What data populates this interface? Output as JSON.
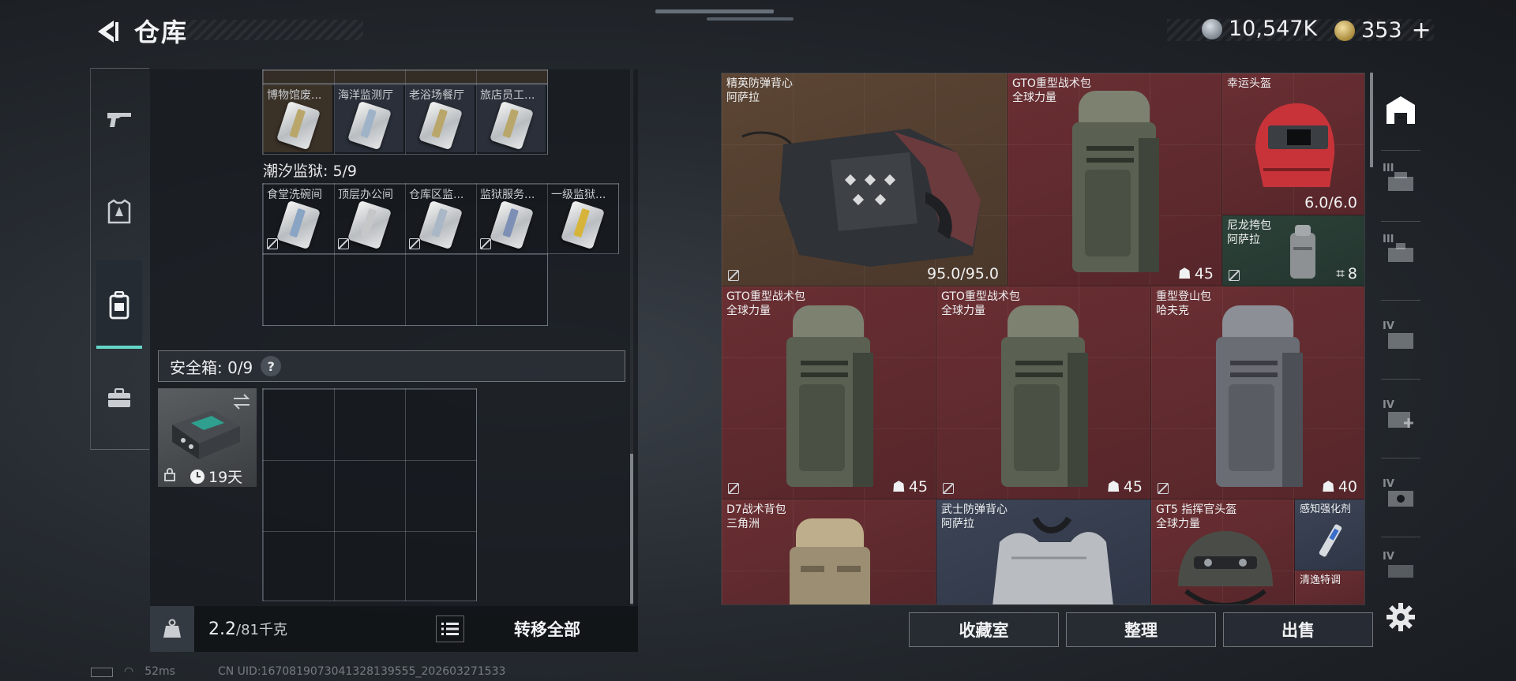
{
  "header": {
    "title": "仓库",
    "currency_silver": "10,547K",
    "currency_gold": "353",
    "currency_plus": "+"
  },
  "nav": {
    "items": [
      "weapons",
      "armor",
      "backpack",
      "briefcase"
    ],
    "active": "backpack"
  },
  "storage": {
    "group1_cards": [
      {
        "label": "博物馆废..."
      },
      {
        "label": "海洋监测厅"
      },
      {
        "label": "老浴场餐厅"
      },
      {
        "label": "旅店员工..."
      }
    ],
    "group2_title": "潮汐监狱: 5/9",
    "group2_cards": [
      {
        "label": "食堂洗碗间"
      },
      {
        "label": "顶层办公间"
      },
      {
        "label": "仓库区监..."
      },
      {
        "label": "监狱服务..."
      },
      {
        "label": "一级监狱..."
      }
    ],
    "safebox_title": "安全箱: 0/9",
    "safebox_help": "?",
    "safebox_item_time": "19天",
    "weight_current": "2.2",
    "weight_capacity": "/81千克",
    "transfer_all": "转移全部"
  },
  "status_bar": {
    "ping": "52ms",
    "uid": "CN UID:1670819073041328139555_202603271533"
  },
  "inventory": {
    "items": [
      {
        "name_line1": "精英防弹背心",
        "name_line2": "阿萨拉",
        "value": "95.0/95.0"
      },
      {
        "name_line1": "GTO重型战术包",
        "name_line2": "全球力量",
        "value": "45"
      },
      {
        "name_line1": "幸运头盔",
        "name_line2": "",
        "value": "6.0/6.0"
      },
      {
        "name_line1": "尼龙挎包",
        "name_line2": "阿萨拉",
        "value": "8"
      },
      {
        "name_line1": "GTO重型战术包",
        "name_line2": "全球力量",
        "value": "45"
      },
      {
        "name_line1": "GTO重型战术包",
        "name_line2": "全球力量",
        "value": "45"
      },
      {
        "name_line1": "重型登山包",
        "name_line2": "哈夫克",
        "value": "40"
      },
      {
        "name_line1": "D7战术背包",
        "name_line2": "三角洲",
        "value": ""
      },
      {
        "name_line1": "武士防弹背心",
        "name_line2": "阿萨拉",
        "value": ""
      },
      {
        "name_line1": "GT5 指挥官头盔",
        "name_line2": "全球力量",
        "value": ""
      },
      {
        "name_line1": "感知强化剂",
        "name_line2": "",
        "value": ""
      },
      {
        "name_line1": "清逸特调",
        "name_line2": "",
        "value": ""
      }
    ],
    "tab_levels": [
      "III",
      "III",
      "IV",
      "IV",
      "IV",
      "IV"
    ],
    "buttons": {
      "collection": "收藏室",
      "organize": "整理",
      "sell": "出售"
    }
  },
  "colors": {
    "accent": "#64d6c7",
    "red_rarity": "#6a2f33",
    "gold_rarity": "#5c4534",
    "blue_rarity": "#3c4456",
    "green_rarity": "#2c4239"
  }
}
